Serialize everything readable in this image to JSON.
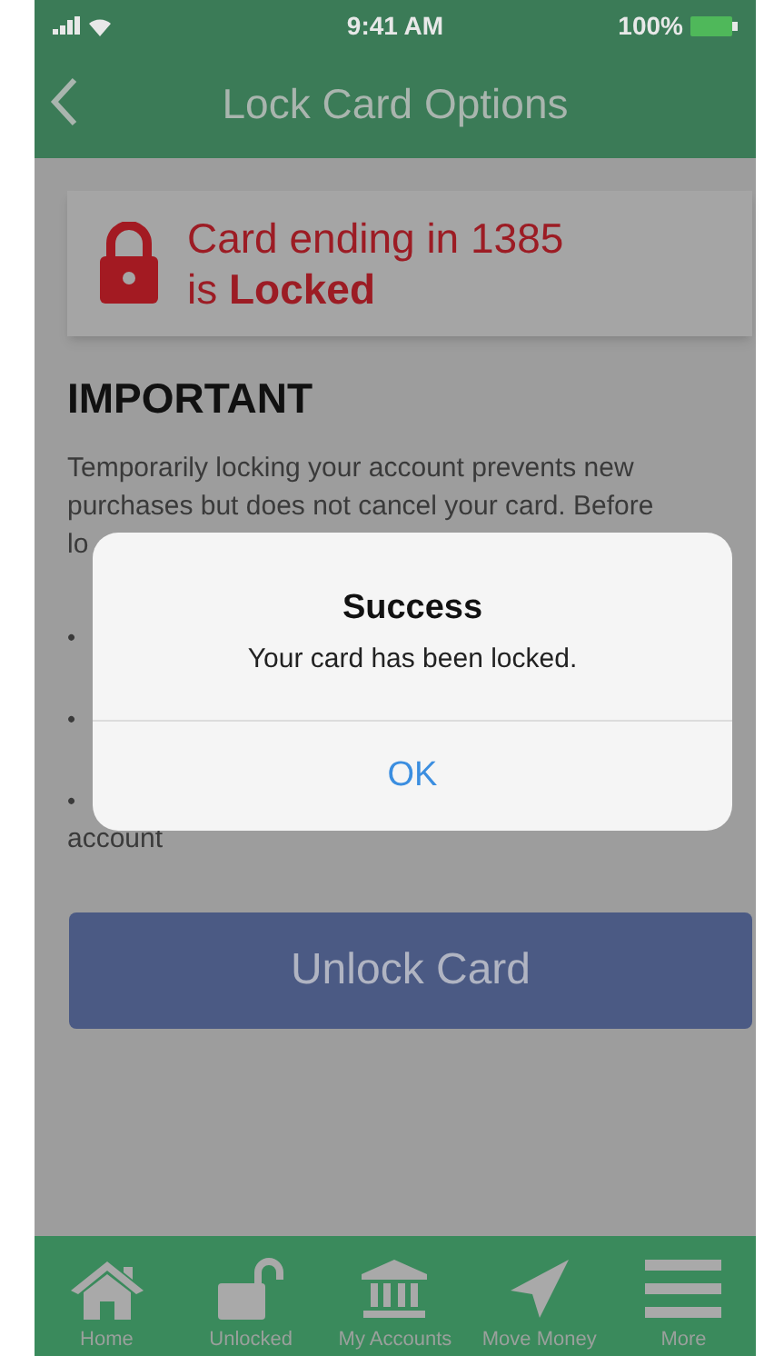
{
  "status_bar": {
    "time": "9:41 AM",
    "battery": "100%"
  },
  "header": {
    "title": "Lock Card Options"
  },
  "status_card": {
    "text": "Card ending in 1385\nis **Locked**"
  },
  "important": {
    "heading": "IMPORTANT",
    "text": "Temporarily locking your account prevents new purchases but does not cancel your card. Before",
    "fragment": "lo",
    "bullets": [
      "•",
      "•",
      "•"
    ],
    "tail": "account"
  },
  "unlock_button": {
    "label": "Unlock Card"
  },
  "dialog": {
    "title": "Success",
    "message": "Your card has been locked.",
    "button": "OK"
  },
  "tab_bar": [
    {
      "kind": "home",
      "label": "Home"
    },
    {
      "kind": "unlock",
      "label": "Unlocked"
    },
    {
      "kind": "bank",
      "label": "My Accounts"
    },
    {
      "kind": "send",
      "label": "Move Money"
    },
    {
      "kind": "menu",
      "label": "More"
    }
  ]
}
